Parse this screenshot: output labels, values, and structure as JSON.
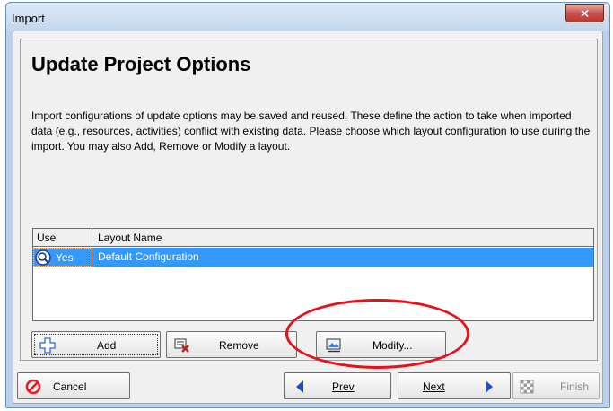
{
  "window": {
    "title": "Import",
    "close_symbol": "✕"
  },
  "page": {
    "title": "Update Project Options",
    "description": "Import configurations of update options may be saved and reused.  These define the action to take when imported data (e.g., resources, activities) conflict with existing data.  Please choose which layout configuration to use during the import. You may also Add, Remove or Modify a layout."
  },
  "table": {
    "headers": {
      "use": "Use",
      "layout_name": "Layout Name"
    },
    "rows": [
      {
        "use": "Yes",
        "layout_name": "Default Configuration",
        "selected": true,
        "icon": "magnifier-icon"
      }
    ]
  },
  "actions": {
    "add_label": "Add",
    "remove_label": "Remove",
    "modify_label": "Modify..."
  },
  "nav": {
    "cancel_label": "Cancel",
    "prev_label": "Prev",
    "next_label": "Next",
    "finish_label": "Finish"
  },
  "colors": {
    "selection": "#3399ff",
    "highlight_ellipse": "#e8101a",
    "cancel_icon": "#e0202a",
    "nav_arrow": "#1c4fc4"
  }
}
